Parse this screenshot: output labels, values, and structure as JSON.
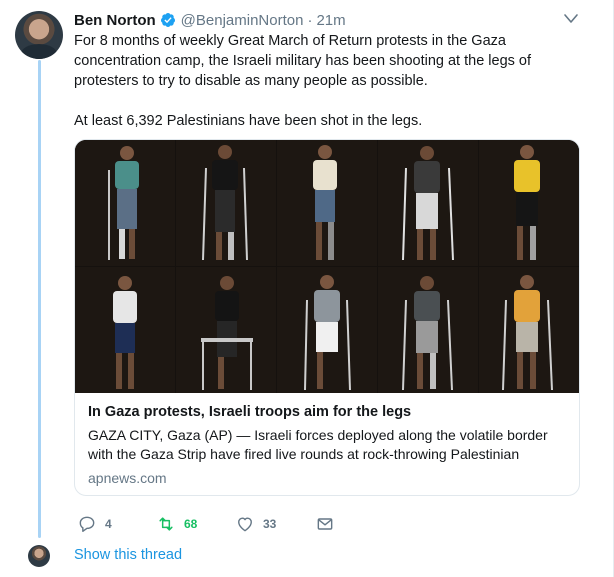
{
  "tweet": {
    "author_name": "Ben Norton",
    "handle": "@BenjaminNorton",
    "separator": "·",
    "time": "21m",
    "verified": true,
    "paragraphs": [
      "For 8 months of weekly Great March of Return protests in the Gaza concentration camp, the Israeli military has been shooting at the legs of protesters to try to disable as many people as possible.",
      "At least 6,392 Palestinians have been shot in the legs."
    ]
  },
  "card": {
    "image_icon": "photo-grid-of-ten-protesters-with-crutches",
    "title": "In Gaza protests, Israeli troops aim for the legs",
    "description": "GAZA CITY, Gaza (AP) — Israeli forces deployed along the volatile border with the Gaza Strip have fired live rounds at rock-throwing Palestinian",
    "domain": "apnews.com"
  },
  "actions": {
    "reply_count": "4",
    "retweet_count": "68",
    "like_count": "33"
  },
  "thread": {
    "show_label": "Show this thread"
  },
  "colors": {
    "accent": "#1b95e0",
    "retweet_active": "#17bf63",
    "muted": "#657786",
    "thread_line": "#a8d3f5",
    "verified": "#1da1f2"
  }
}
